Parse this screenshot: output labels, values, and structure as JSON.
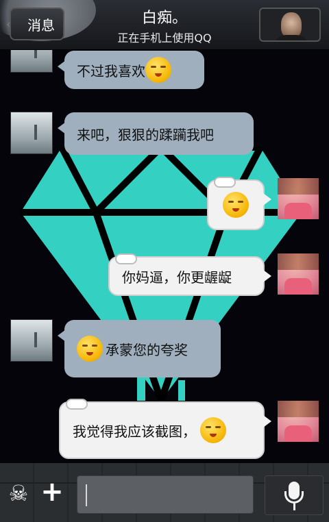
{
  "header": {
    "back_label": "消息",
    "title": "白痴。",
    "subtitle": "正在手机上使用QQ"
  },
  "messages": [
    {
      "side": "left",
      "text": "不过我喜欢",
      "emoji": "kiss-emoji"
    },
    {
      "side": "left",
      "text": "来吧，狠狠的蹂躏我吧"
    },
    {
      "side": "right",
      "text": "",
      "emoji": "smirk-emoji"
    },
    {
      "side": "right",
      "text": "你妈逼，你更龌龊"
    },
    {
      "side": "left",
      "text": "承蒙您的夸奖",
      "emoji": "kiss-emoji"
    },
    {
      "side": "right",
      "text": "我觉得我应该截图，",
      "emoji": "dizzy-emoji"
    }
  ],
  "colors": {
    "diamond": "#34d1c3",
    "left_bubble": "#9fafbd",
    "right_bubble": "#f2f2f2"
  }
}
